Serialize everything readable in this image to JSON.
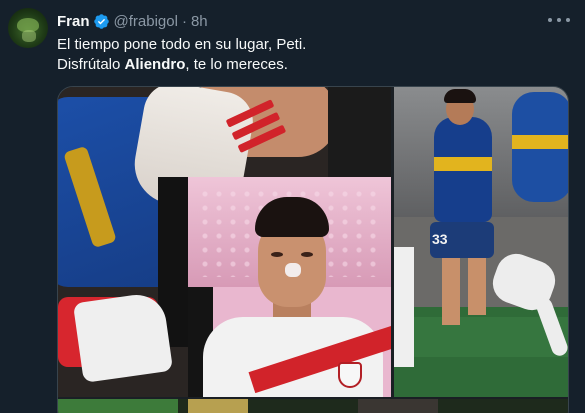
{
  "tweet": {
    "display_name": "Fran",
    "handle": "@frabigol",
    "separator": "·",
    "timestamp": "8h",
    "text_line1": "El tiempo pone todo en su lugar, Peti.",
    "text_line2_prefix": "Disfrútalo ",
    "text_line2_bold": "Aliendro",
    "text_line2_suffix": ", te lo mereces.",
    "jersey_number": "33"
  },
  "icons": {
    "verified": "verified-badge-icon",
    "more": "more-options-icon"
  },
  "colors": {
    "background": "#15202b",
    "text": "#f7f9f9",
    "secondary_text": "#8b98a5",
    "verified_blue": "#1d9bf0",
    "border": "#38444d"
  }
}
